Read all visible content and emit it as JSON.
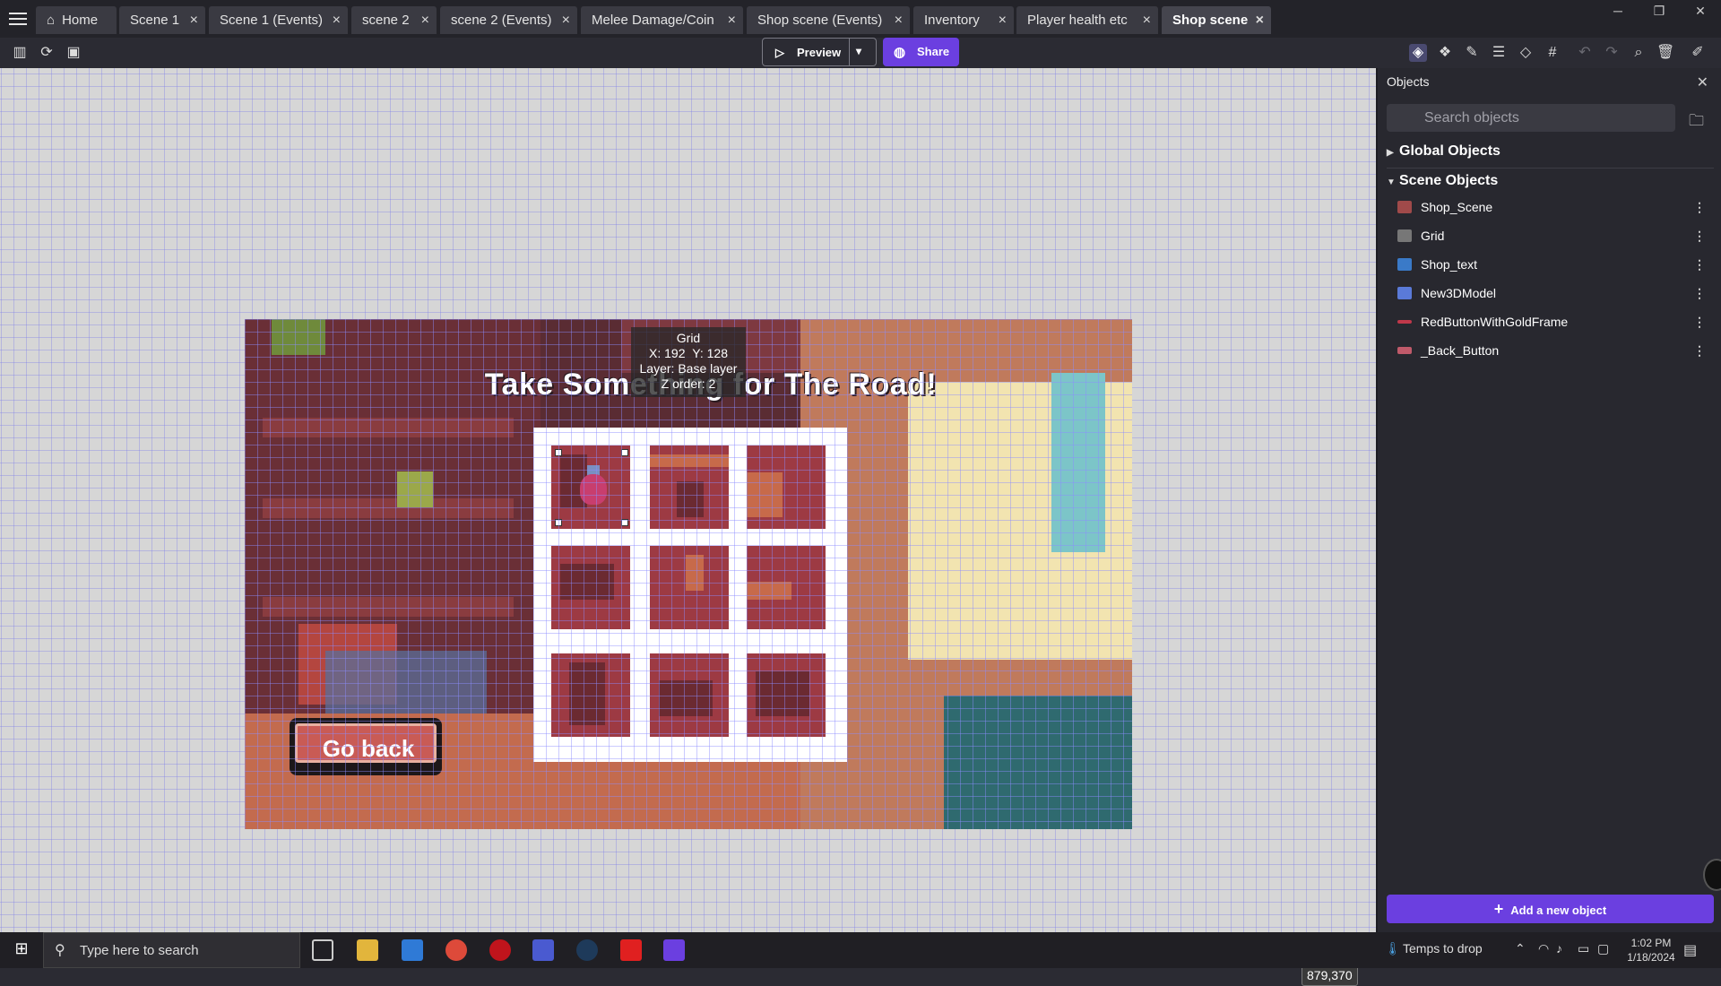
{
  "tabs": [
    {
      "label": "Home",
      "icon": "home-icon",
      "closable": false
    },
    {
      "label": "Scene 1",
      "closable": true
    },
    {
      "label": "Scene 1 (Events)",
      "closable": true
    },
    {
      "label": "scene 2",
      "closable": true
    },
    {
      "label": "scene 2 (Events)",
      "closable": true
    },
    {
      "label": "Melee Damage/Coin",
      "closable": true
    },
    {
      "label": "Shop scene (Events)",
      "closable": true
    },
    {
      "label": "Inventory",
      "closable": true
    },
    {
      "label": "Player health etc",
      "closable": true
    },
    {
      "label": "Shop scene",
      "closable": true,
      "active": true
    }
  ],
  "toolbar": {
    "preview_label": "Preview",
    "share_label": "Share"
  },
  "scene": {
    "title_text": "Take Something for The Road!",
    "go_back_label": "Go back",
    "tooltip": {
      "object": "Grid",
      "x": "X: 192",
      "y": "Y: 128",
      "layer": "Layer: Base layer",
      "zorder": "Z order: 2"
    },
    "cursor_coords": "879,370"
  },
  "objects_panel": {
    "title": "Objects",
    "search_placeholder": "Search objects",
    "global_group": "Global Objects",
    "scene_group": "Scene Objects",
    "items": [
      {
        "name": "Shop_Scene",
        "icon_color": "#a04a4a"
      },
      {
        "name": "Grid",
        "icon_color": "#777777"
      },
      {
        "name": "Shop_text",
        "icon_color": "#3a7ac8"
      },
      {
        "name": "New3DModel",
        "icon_color": "#5a7ad8"
      },
      {
        "name": "RedButtonWithGoldFrame",
        "icon_color": "#c0384a"
      },
      {
        "name": "_Back_Button",
        "icon_color": "#c05a6a"
      }
    ],
    "add_button": "Add a new object"
  },
  "taskbar": {
    "search_placeholder": "Type here to search",
    "weather": "Temps to drop",
    "time": "1:02 PM",
    "date": "1/18/2024"
  },
  "colors": {
    "accent": "#6b3fe0",
    "canvas_bg": "#d6d6d6",
    "panel_bg": "#28282f"
  }
}
